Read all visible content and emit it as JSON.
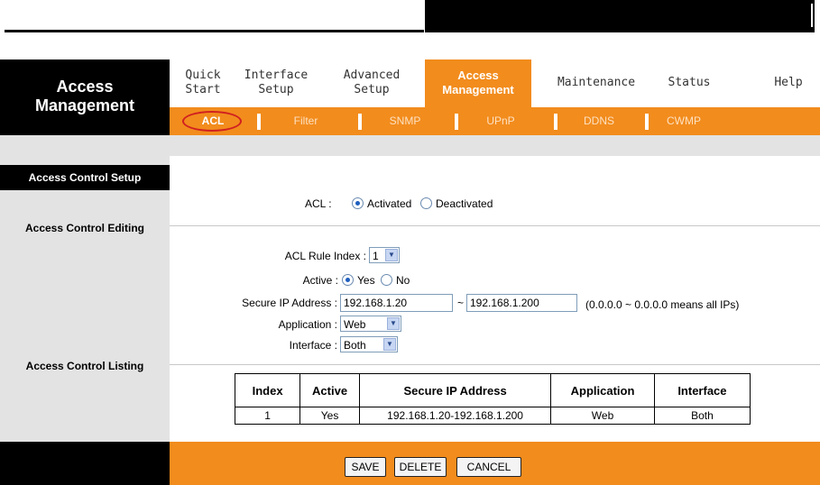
{
  "brand": {
    "line1": "Access",
    "line2": "Management"
  },
  "main_nav": [
    {
      "line1": "Quick",
      "line2": "Start"
    },
    {
      "line1": "Interface",
      "line2": "Setup"
    },
    {
      "line1": "Advanced",
      "line2": "Setup"
    },
    {
      "line1": "Access",
      "line2": "Management",
      "active": true
    },
    {
      "line1": "Maintenance",
      "line2": ""
    },
    {
      "line1": "Status",
      "line2": ""
    },
    {
      "line1": "Help",
      "line2": ""
    }
  ],
  "sub_nav": [
    "ACL",
    "Filter",
    "SNMP",
    "UPnP",
    "DDNS",
    "CWMP"
  ],
  "sidebar": {
    "title": "Access Control Setup",
    "editing": "Access Control Editing",
    "listing": "Access Control Listing"
  },
  "acl": {
    "label": "ACL :",
    "activated": "Activated",
    "deactivated": "Deactivated",
    "selected": "Activated"
  },
  "form": {
    "rule_index_label": "ACL Rule Index :",
    "rule_index_value": "1",
    "active_label": "Active :",
    "active_yes": "Yes",
    "active_no": "No",
    "secure_ip_label": "Secure IP Address :",
    "ip_start": "192.168.1.20",
    "ip_sep": "~",
    "ip_end": "192.168.1.200",
    "ip_hint": "(0.0.0.0 ~ 0.0.0.0 means all IPs)",
    "application_label": "Application :",
    "application_value": "Web",
    "interface_label": "Interface :",
    "interface_value": "Both"
  },
  "table": {
    "headers": [
      "Index",
      "Active",
      "Secure IP Address",
      "Application",
      "Interface"
    ],
    "rows": [
      [
        "1",
        "Yes",
        "192.168.1.20-192.168.1.200",
        "Web",
        "Both"
      ]
    ]
  },
  "buttons": {
    "save": "SAVE",
    "delete": "DELETE",
    "cancel": "CANCEL"
  },
  "colors": {
    "accent": "#f28c1d",
    "dark": "#000000",
    "panel": "#e3e3e3"
  }
}
